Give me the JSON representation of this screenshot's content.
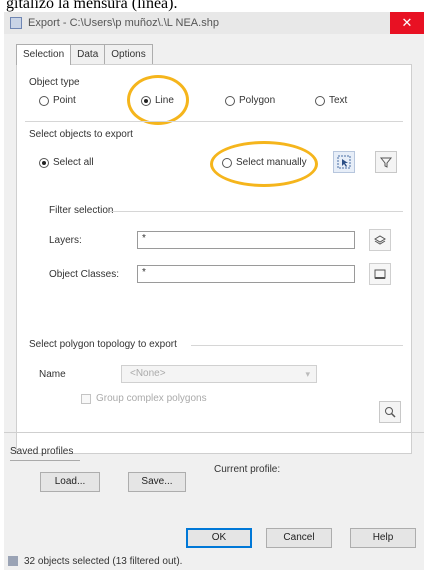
{
  "caption": "gitalizó la mensura (línea).",
  "window": {
    "title": "Export - C:\\Users\\p muñoz\\.\\L NEA.shp",
    "close": "✕"
  },
  "tabs": [
    {
      "label": "Selection"
    },
    {
      "label": "Data"
    },
    {
      "label": "Options"
    }
  ],
  "object_type": {
    "label": "Object type",
    "options": [
      {
        "label": "Point"
      },
      {
        "label": "Line"
      },
      {
        "label": "Polygon"
      },
      {
        "label": "Text"
      }
    ]
  },
  "select_objects": {
    "label": "Select objects to export",
    "select_all": "Select all",
    "select_manually": "Select manually"
  },
  "filter": {
    "label": "Filter selection",
    "layers_label": "Layers:",
    "layers_value": "*",
    "classes_label": "Object Classes:",
    "classes_value": "*"
  },
  "topology": {
    "label": "Select polygon topology to export",
    "name_label": "Name",
    "name_value": "<None>",
    "group_checkbox": "Group complex polygons"
  },
  "profiles": {
    "label": "Saved profiles",
    "load": "Load...",
    "save": "Save...",
    "current": "Current profile:"
  },
  "buttons": {
    "ok": "OK",
    "cancel": "Cancel",
    "help": "Help"
  },
  "status": "32 objects selected (13 filtered out).",
  "colors": {
    "highlight": "#f5b51c",
    "close_red": "#e81123"
  }
}
